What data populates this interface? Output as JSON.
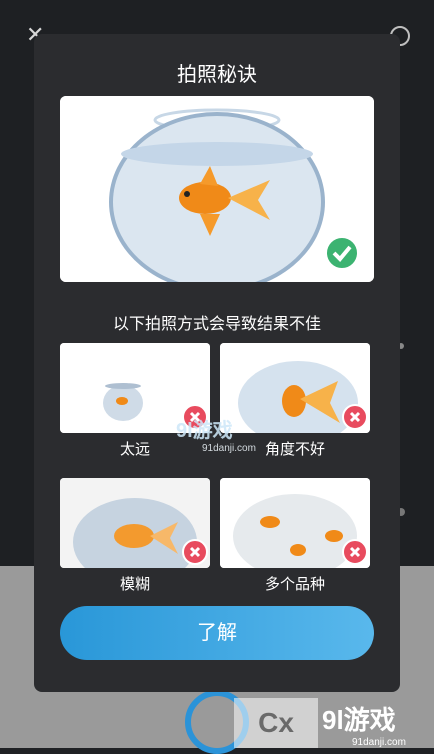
{
  "dialog": {
    "title": "拍照秘诀",
    "subtitle": "以下拍照方式会导致结果不佳",
    "button_label": "了解",
    "examples": [
      {
        "caption": "太远"
      },
      {
        "caption": "角度不好"
      },
      {
        "caption": "模糊"
      },
      {
        "caption": "多个品种"
      }
    ]
  },
  "watermark": {
    "logo_text": "9l游戏",
    "url": "91danji.com",
    "corner_text": "9l游戏",
    "corner_url": "91danji.com",
    "badge_text": "Cx"
  },
  "icons": {
    "good": "check-icon",
    "bad": "cross-icon",
    "close": "close-icon",
    "settings": "gear-icon"
  },
  "colors": {
    "accent_start": "#2997d8",
    "accent_end": "#59b8ec",
    "good": "#3cb371",
    "bad": "#e84b5e"
  }
}
